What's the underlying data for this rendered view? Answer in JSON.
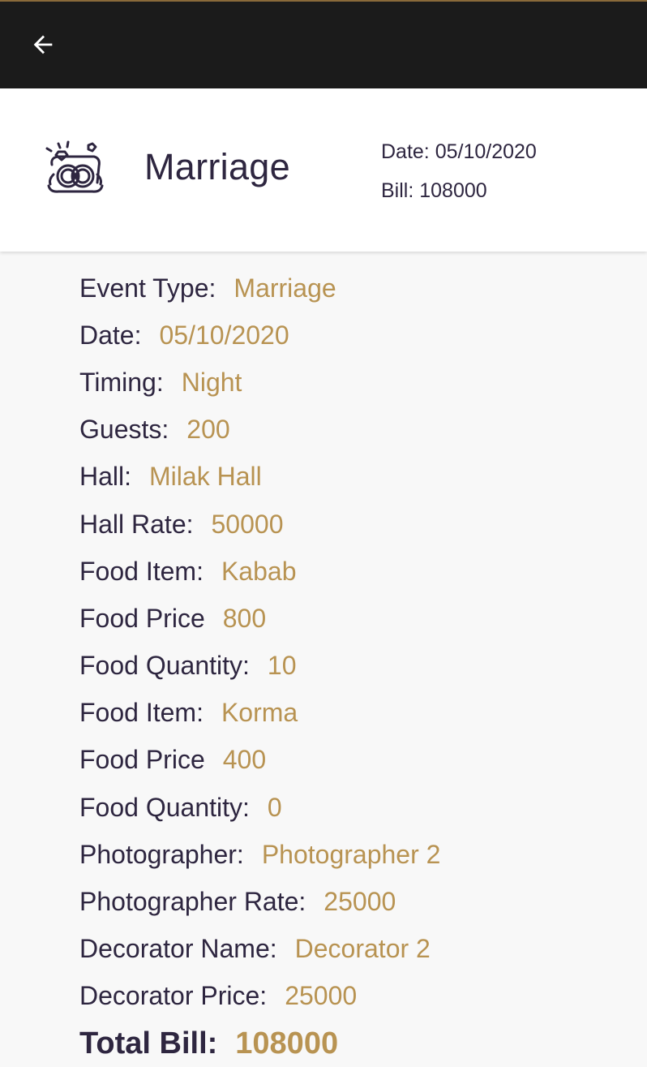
{
  "header": {
    "back_icon": "arrow-left-icon"
  },
  "card": {
    "icon": "wedding-rings-icon",
    "title": "Marriage",
    "date": "Date: 05/10/2020",
    "bill": "Bill: 108000"
  },
  "details": [
    {
      "label": "Event Type:",
      "value": "Marriage"
    },
    {
      "label": "Date:",
      "value": "05/10/2020"
    },
    {
      "label": "Timing:",
      "value": "Night"
    },
    {
      "label": "Guests:",
      "value": "200"
    },
    {
      "label": "Hall:",
      "value": "Milak Hall"
    },
    {
      "label": "Hall Rate:",
      "value": "50000"
    },
    {
      "label": "Food Item:",
      "value": "Kabab"
    },
    {
      "label": "Food Price",
      "value": "800"
    },
    {
      "label": "Food Quantity:",
      "value": "10"
    },
    {
      "label": "Food Item:",
      "value": "Korma"
    },
    {
      "label": "Food Price",
      "value": "400"
    },
    {
      "label": "Food Quantity:",
      "value": "0"
    },
    {
      "label": "Photographer:",
      "value": "Photographer 2"
    },
    {
      "label": "Photographer Rate:",
      "value": "25000"
    },
    {
      "label": "Decorator Name:",
      "value": "Decorator 2"
    },
    {
      "label": "Decorator Price:",
      "value": "25000"
    }
  ],
  "total": {
    "label": "Total Bill:",
    "value": "108000"
  },
  "colors": {
    "topbar": "#1b1b1b",
    "label": "#2e2640",
    "value": "#b89352"
  }
}
